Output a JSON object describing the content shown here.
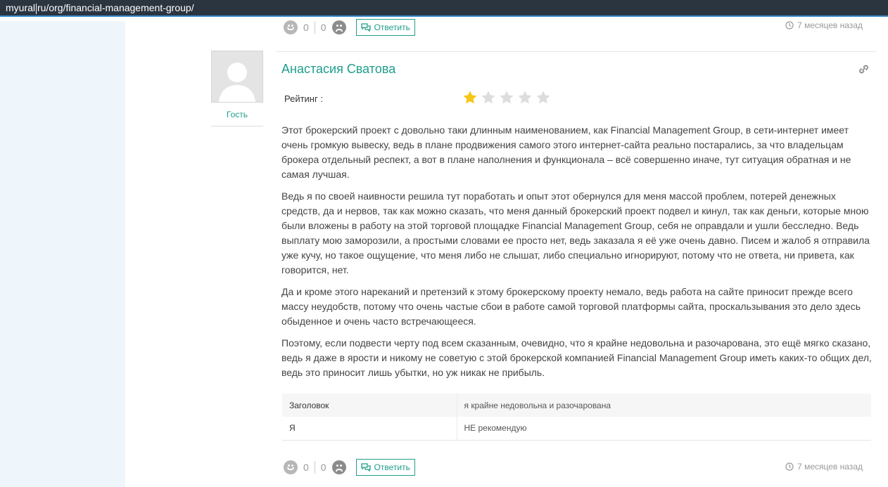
{
  "browser": {
    "url_before_caret": "myural",
    "url_after_caret": "ru/org/financial-management-group/"
  },
  "prev_review": {
    "likes": "0",
    "dislikes": "0",
    "reply_label": "Ответить",
    "time": "7 месяцев назад"
  },
  "review": {
    "author": "Анастасия Сватова",
    "user_role": "Гость",
    "rating_label": "Рейтинг :",
    "rating_value": 1,
    "rating_max": 5,
    "paragraphs": [
      "Этот брокерский проект с довольно таки длинным наименованием, как Financial Management Group, в сети-интернет имеет очень громкую вывеску, ведь в плане продвижения самого этого интернет-сайта реально постарались, за что владельцам брокера отдельный респект, а вот в плане наполнения и функционала – всё совершенно иначе, тут ситуация обратная и не самая лучшая.",
      "Ведь я по своей наивности решила тут поработать и опыт этот обернулся для меня массой проблем, потерей денежных средств, да и нервов, так как можно сказать, что меня данный брокерский проект подвел и кинул, так как деньги, которые мною были вложены в работу на этой торговой площадке Financial Management Group, себя не оправдали и ушли бесследно. Ведь выплату мою заморозили, а простыми словами ее просто нет, ведь заказала я её уже очень давно. Писем и жалоб я отправила уже кучу, но такое ощущение, что меня либо не слышат, либо специально игнорируют, потому что не ответа, ни привета, как говорится, нет.",
      "Да и кроме этого нареканий и претензий к этому брокерскому проекту немало, ведь работа на сайте приносит прежде всего массу неудобств, потому что очень частые сбои в работе самой торговой платформы сайта, проскальзывания это дело здесь обыденное и очень часто встречающееся.",
      "Поэтому, если подвести черту под всем сказанным, очевидно, что я крайне недовольна и разочарована, это ещё мягко сказано, ведь я даже в ярости и никому не советую с этой брокерской компанией Financial Management Group иметь каких-то общих дел, ведь это приносит лишь убытки, но уж никак не прибыль."
    ],
    "fields": [
      {
        "label": "Заголовок",
        "value": "я крайне недовольна и разочарована"
      },
      {
        "label": "Я",
        "value": "НЕ рекомендую"
      }
    ],
    "likes": "0",
    "dislikes": "0",
    "reply_label": "Ответить",
    "time": "7 месяцев назад"
  },
  "colors": {
    "accent": "#1e9e8a",
    "star_filled": "#f5c518",
    "star_empty": "#dddddd",
    "url_bar": "#2b3540",
    "left_panel": "#eef5fb"
  },
  "icons": [
    "smile-icon",
    "frown-icon",
    "comments-icon",
    "clock-icon",
    "link-icon",
    "star-icon",
    "avatar-icon"
  ]
}
